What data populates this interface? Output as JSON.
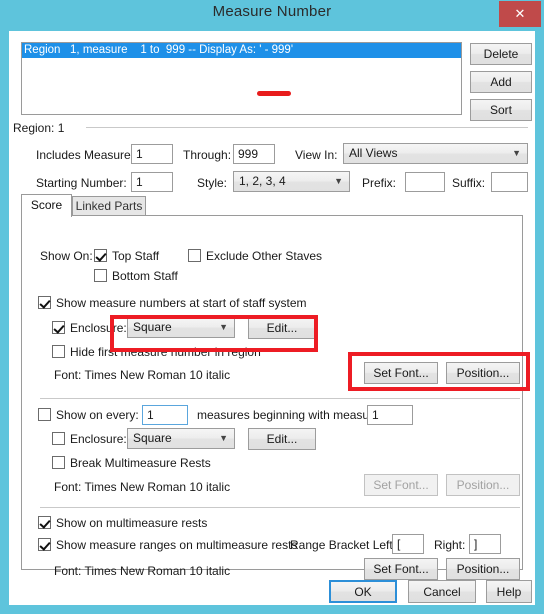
{
  "window": {
    "title": "Measure Number",
    "close_label": "✕",
    "close_icon": "close-icon"
  },
  "region_list": {
    "items": [
      {
        "text": "Region   1, measure    1 to  999 -- Display As: ' - 999'",
        "selected": true
      }
    ],
    "buttons": {
      "delete": "Delete",
      "add": "Add",
      "sort": "Sort"
    }
  },
  "region_header": {
    "label": "Region: 1"
  },
  "region_fields": {
    "includes_measure_label": "Includes Measure:",
    "includes_measure_value": "1",
    "through_label": "Through:",
    "through_value": "999",
    "view_in_label": "View In:",
    "view_in_value": "All Views",
    "starting_number_label": "Starting Number:",
    "starting_number_value": "1",
    "style_label": "Style:",
    "style_value": "1, 2, 3, 4",
    "prefix_label": "Prefix:",
    "prefix_value": "",
    "suffix_label": "Suffix:",
    "suffix_value": ""
  },
  "tabs": [
    {
      "label": "Score",
      "active": true
    },
    {
      "label": "Linked Parts",
      "active": false
    }
  ],
  "score_tab": {
    "show_on_label": "Show On:",
    "top_staff": {
      "label": "Top Staff",
      "checked": true
    },
    "exclude_other_staves": {
      "label": "Exclude Other Staves",
      "checked": false
    },
    "bottom_staff": {
      "label": "Bottom Staff",
      "checked": false
    },
    "start_of_system": {
      "label": "Show measure numbers at start of staff system",
      "checked": true
    },
    "group1": {
      "enclosure": {
        "label": "Enclosure:",
        "checked": true,
        "value": "Square"
      },
      "edit_button": "Edit...",
      "hide_first": {
        "label": "Hide first measure number in region",
        "checked": false
      },
      "font_label": "Font:  Times New Roman 10  italic",
      "set_font_button": "Set Font...",
      "position_button": "Position..."
    },
    "group2": {
      "show_on_every": {
        "label": "Show on every:",
        "checked": false
      },
      "every_value": "1",
      "measures_beginning_label": "measures beginning with measure:",
      "beginning_value": "1",
      "enclosure": {
        "label": "Enclosure:",
        "checked": false,
        "value": "Square"
      },
      "edit_button": "Edit...",
      "break_multimeasure": {
        "label": "Break Multimeasure Rests",
        "checked": false
      },
      "font_label": "Font:  Times New Roman 10  italic",
      "set_font_button": "Set Font...",
      "position_button": "Position...",
      "buttons_disabled": true
    },
    "group3": {
      "show_on_multimeasure": {
        "label": "Show on multimeasure rests",
        "checked": true
      },
      "show_ranges": {
        "label": "Show measure ranges on multimeasure rests",
        "checked": true
      },
      "range_bracket_left_label": "Range Bracket Left:",
      "range_bracket_left_value": "[",
      "range_bracket_right_label": "Right:",
      "range_bracket_right_value": "]",
      "font_label": "Font:  Times New Roman 10  italic",
      "set_font_button": "Set Font...",
      "position_button": "Position..."
    }
  },
  "footer": {
    "ok": "OK",
    "cancel": "Cancel",
    "help": "Help"
  },
  "annotations": {
    "highlight_color": "#ED1C24",
    "marker_color": "#E81C1C"
  },
  "colors": {
    "titlebar": "#5EC4DC",
    "close_button": "#C04A4A",
    "selection": "#1E90E8",
    "focus_border": "#2c8fd8"
  }
}
